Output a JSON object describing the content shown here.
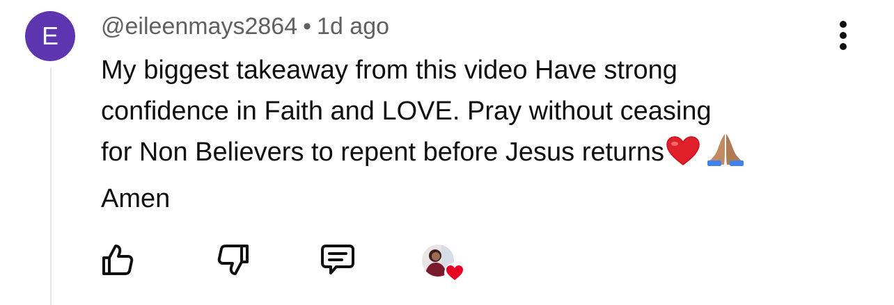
{
  "comment": {
    "avatar_letter": "E",
    "avatar_color": "#5e35b1",
    "author": "@eileenmays2864",
    "separator": "•",
    "timestamp": "1d ago",
    "text_lines": [
      "My biggest takeaway from this video Have strong",
      "confidence in Faith and LOVE. Pray without ceasing",
      "for Non Believers to repent before Jesus returns",
      "Amen"
    ],
    "emojis": [
      "heart-emoji",
      "praying-hands-emoji"
    ]
  },
  "actions": {
    "like_icon": "thumbs-up-icon",
    "dislike_icon": "thumbs-down-icon",
    "reply_icon": "reply-icon",
    "creator_heart_icon": "creator-heart-icon"
  },
  "colors": {
    "meta_text": "#606060",
    "text": "#0f0f0f",
    "heart_red": "#e60023",
    "thread_line": "#e5e5e5"
  }
}
